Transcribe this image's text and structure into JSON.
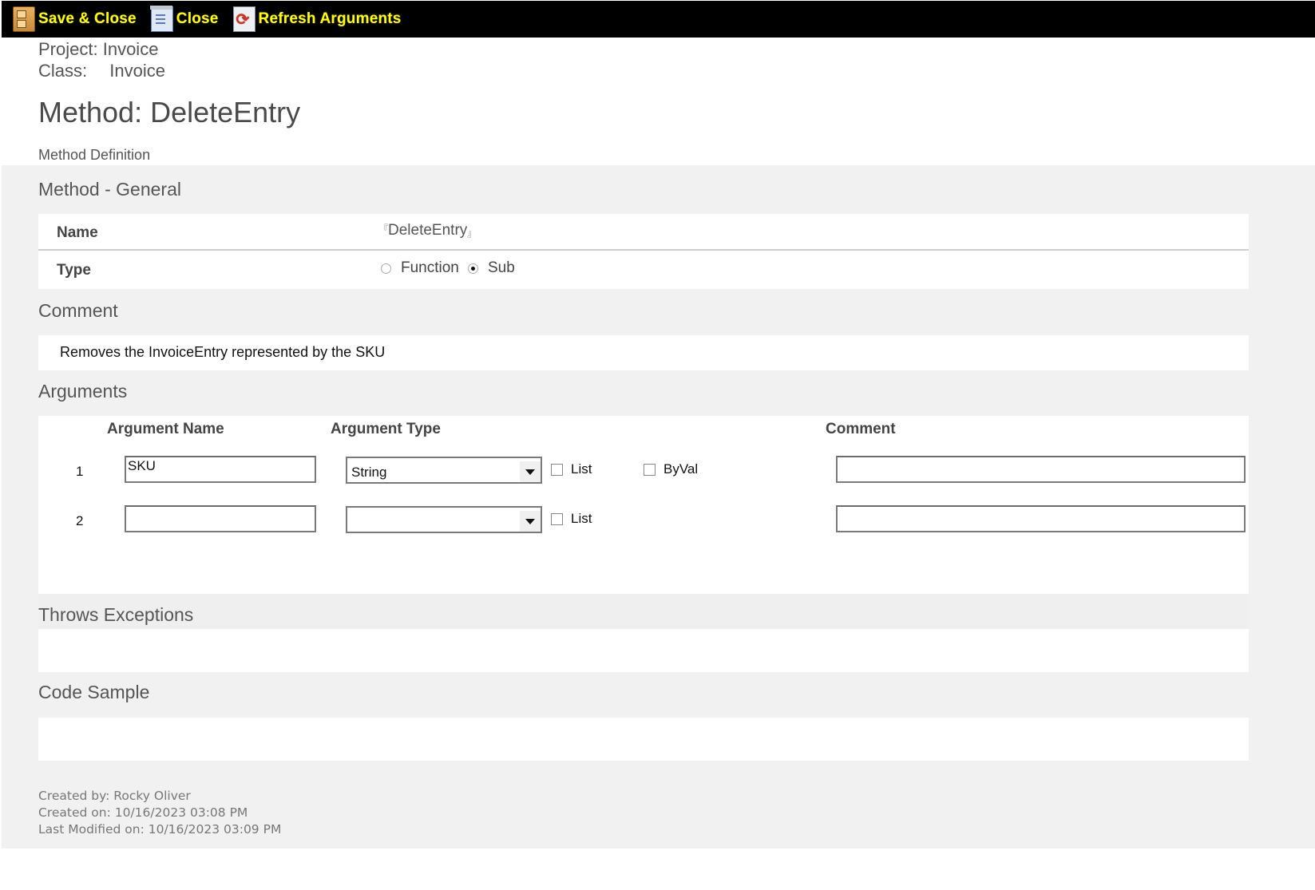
{
  "toolbar": {
    "buttons": [
      {
        "label": "Save & Close",
        "icon": "file-cabinet-icon"
      },
      {
        "label": "Close",
        "icon": "document-close-icon"
      },
      {
        "label": "Refresh Arguments",
        "icon": "refresh-icon"
      }
    ]
  },
  "header": {
    "project_label": "Project:",
    "project_value": "Invoice",
    "class_label": "Class:",
    "class_value": "Invoice",
    "title": "Method: DeleteEntry",
    "subtitle": "Method Definition"
  },
  "general": {
    "section_title": "Method - General",
    "name_label": "Name",
    "name_value": "DeleteEntry",
    "type_label": "Type",
    "type_options": [
      {
        "label": "Function",
        "checked": false
      },
      {
        "label": "Sub",
        "checked": true
      }
    ]
  },
  "comment": {
    "section_title": "Comment",
    "text": "Removes the InvoiceEntry represented by the SKU"
  },
  "arguments": {
    "section_title": "Arguments",
    "columns": [
      "Argument Name",
      "Argument Type",
      "Comment"
    ],
    "rows": [
      {
        "index": "1",
        "name": "SKU",
        "type": "String",
        "list_label": "List",
        "list_checked": false,
        "byval_label": "ByVal",
        "byval_checked": false,
        "comment": ""
      },
      {
        "index": "2",
        "name": "",
        "type": "",
        "list_label": "List",
        "list_checked": false,
        "comment": ""
      }
    ]
  },
  "throws": {
    "section_title": "Throws Exceptions"
  },
  "code_sample": {
    "section_title": "Code Sample"
  },
  "footer": {
    "created_by": "Created by: Rocky Oliver",
    "created_on": "Created on: 10/16/2023 03:08 PM",
    "modified_on": "Last Modified on: 10/16/2023 03:09 PM"
  }
}
